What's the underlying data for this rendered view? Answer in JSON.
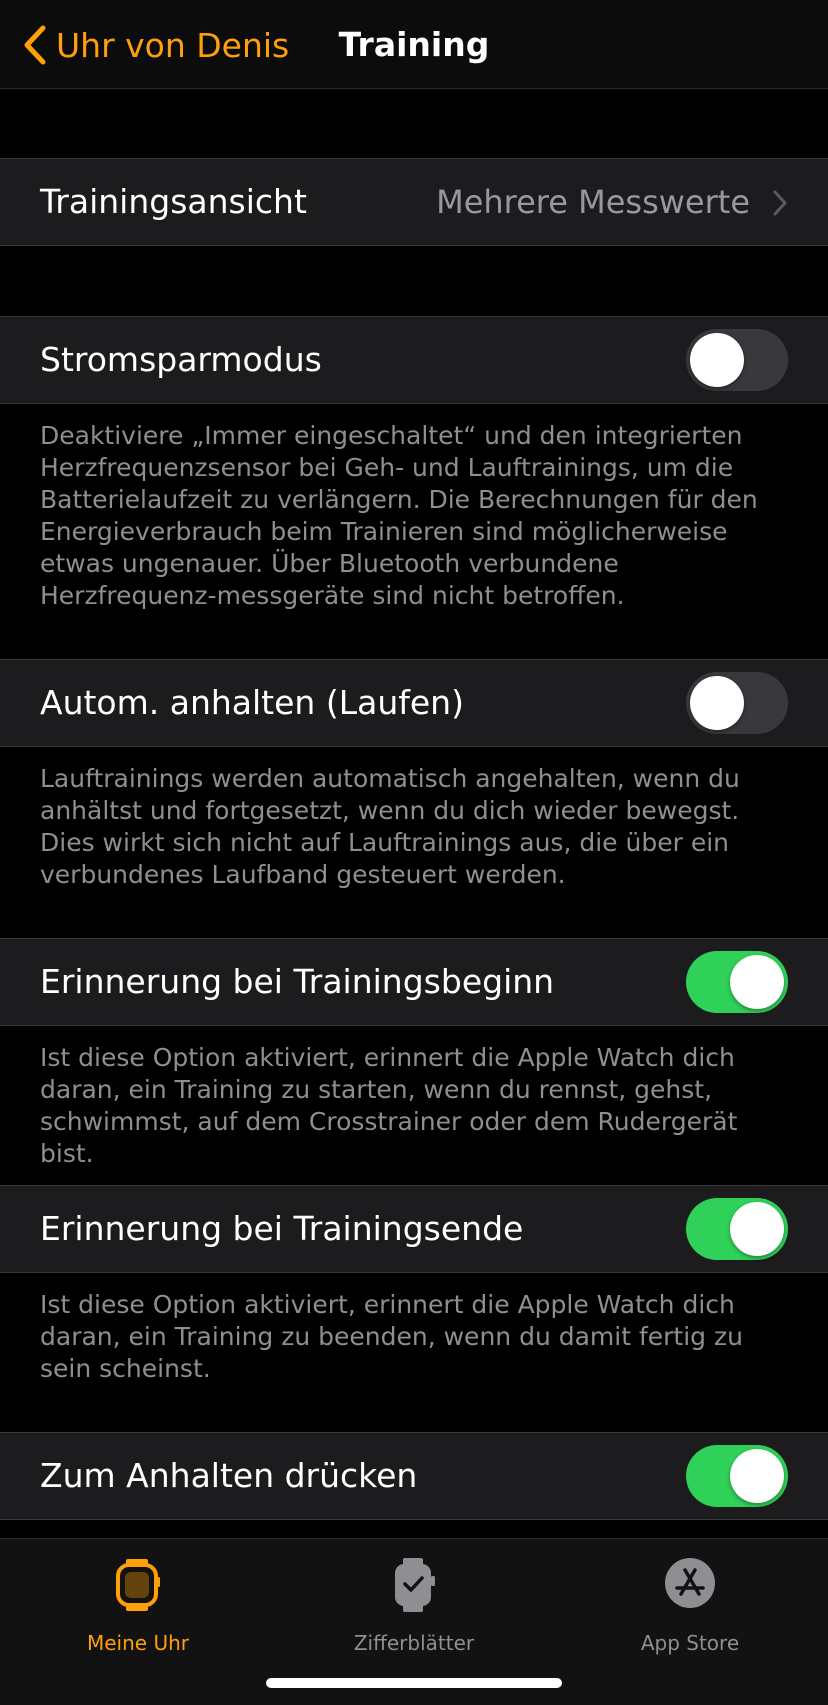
{
  "nav": {
    "back_label": "Uhr von Denis",
    "title": "Training"
  },
  "rows": {
    "view": {
      "label": "Trainingsansicht",
      "value": "Mehrere Messwerte"
    },
    "power_saving": {
      "label": "Stromsparmodus",
      "on": false,
      "footer": "Deaktiviere „Immer eingeschaltet“ und den integrierten Herzfrequenzsensor bei Geh- und Lauftrainings, um die Batterielaufzeit zu verlängern. Die Berechnungen für den Energieverbrauch beim Trainieren sind möglicherweise etwas ungenauer. Über Bluetooth verbundene Herzfrequenz-messgeräte sind nicht betroffen."
    },
    "auto_pause": {
      "label": "Autom. anhalten (Laufen)",
      "on": false,
      "footer": "Lauftrainings werden automatisch angehalten, wenn du anhältst und fortgesetzt, wenn du dich wieder bewegst. Dies wirkt sich nicht auf Lauftrainings aus, die über ein verbundenes Laufband gesteuert werden."
    },
    "start_reminder": {
      "label": "Erinnerung bei Trainingsbeginn",
      "on": true,
      "footer": "Ist diese Option aktiviert, erinnert die Apple Watch dich daran, ein Training zu starten, wenn du rennst, gehst, schwimmst, auf dem Crosstrainer oder dem Rudergerät bist."
    },
    "end_reminder": {
      "label": "Erinnerung bei Trainingsende",
      "on": true,
      "footer": "Ist diese Option aktiviert, erinnert die Apple Watch dich daran, ein Training zu beenden, wenn du damit fertig zu sein scheinst."
    },
    "press_to_pause": {
      "label": "Zum Anhalten drücken",
      "on": true
    }
  },
  "tabs": [
    {
      "label": "Meine Uhr",
      "icon": "watch-icon",
      "active": true
    },
    {
      "label": "Zifferblätter",
      "icon": "watch-face-icon",
      "active": false
    },
    {
      "label": "App Store",
      "icon": "app-store-icon",
      "active": false
    }
  ],
  "colors": {
    "accent": "#ff9f0a",
    "toggle_on": "#30d158",
    "toggle_off": "#39393d",
    "cell_bg": "#1c1c1e"
  }
}
